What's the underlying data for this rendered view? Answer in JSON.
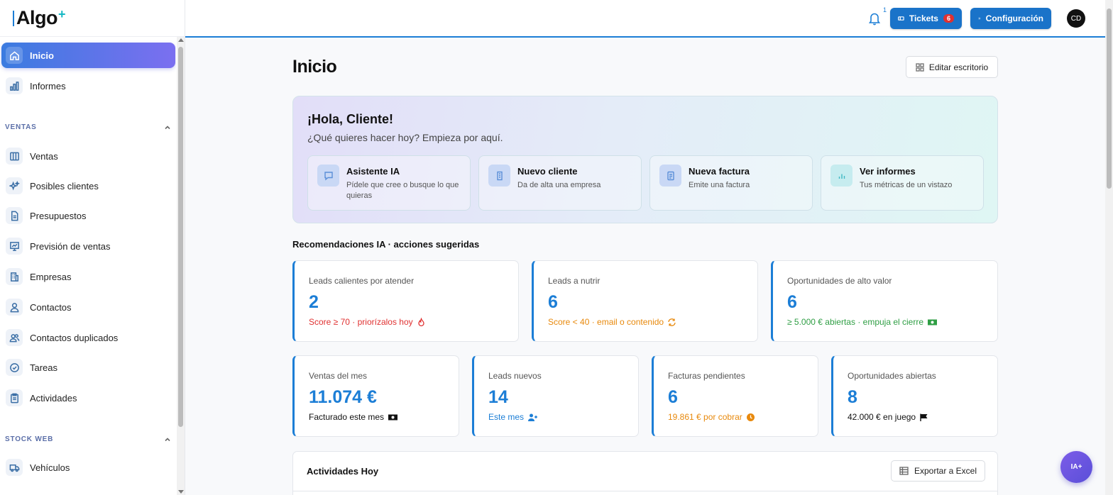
{
  "app": {
    "logo_text": "Algo",
    "logo_plus": "+"
  },
  "topbar": {
    "notifications_count": "1",
    "tickets_label": "Tickets",
    "tickets_badge": "6",
    "config_label": "Configuración",
    "avatar_initials": "CD"
  },
  "sidebar": {
    "items": [
      {
        "label": "Inicio",
        "icon": "home-icon"
      },
      {
        "label": "Informes",
        "icon": "bar-chart-icon"
      }
    ],
    "sections": [
      {
        "title": "VENTAS"
      },
      {
        "title": "STOCK WEB"
      }
    ],
    "ventas_items": [
      {
        "label": "Ventas",
        "icon": "columns-icon"
      },
      {
        "label": "Posibles clientes",
        "icon": "sparkles-icon"
      },
      {
        "label": "Presupuestos",
        "icon": "document-icon"
      },
      {
        "label": "Previsión de ventas",
        "icon": "presentation-chart-icon"
      },
      {
        "label": "Empresas",
        "icon": "building-icon"
      },
      {
        "label": "Contactos",
        "icon": "user-icon"
      },
      {
        "label": "Contactos duplicados",
        "icon": "users-icon"
      },
      {
        "label": "Tareas",
        "icon": "check-circle-icon"
      },
      {
        "label": "Actividades",
        "icon": "clipboard-icon"
      }
    ],
    "stock_items": [
      {
        "label": "Vehículos",
        "icon": "truck-icon"
      }
    ]
  },
  "main": {
    "title": "Inicio",
    "edit_button": "Editar escritorio",
    "hero": {
      "greeting": "¡Hola, Cliente!",
      "subtitle": "¿Qué quieres hacer hoy? Empieza por aquí.",
      "actions": [
        {
          "title": "Asistente IA",
          "desc": "Pídele que cree o busque lo que quieras",
          "icon": "chat-icon"
        },
        {
          "title": "Nuevo cliente",
          "desc": "Da de alta una empresa",
          "icon": "building-icon"
        },
        {
          "title": "Nueva factura",
          "desc": "Emite una factura",
          "icon": "invoice-icon"
        },
        {
          "title": "Ver informes",
          "desc": "Tus métricas de un vistazo",
          "icon": "bar-chart-icon"
        }
      ]
    },
    "recommendations_title": "Recomendaciones IA · acciones sugeridas",
    "recommendations": [
      {
        "title": "Leads calientes por atender",
        "value": "2",
        "sub": "Score ≥ 70 · priorízalos hoy",
        "sub_color": "#e03131",
        "icon": "fire-icon"
      },
      {
        "title": "Leads a nutrir",
        "value": "6",
        "sub": "Score < 40 · email o contenido",
        "sub_color": "#e8890c",
        "icon": "refresh-icon"
      },
      {
        "title": "Oportunidades de alto valor",
        "value": "6",
        "sub": "≥ 5.000 € abiertas · empuja el cierre",
        "sub_color": "#2f9e44",
        "icon": "money-icon"
      }
    ],
    "kpis": [
      {
        "title": "Ventas del mes",
        "value": "11.074 €",
        "sub": "Facturado este mes",
        "sub_color": "#111111",
        "icon": "money-icon"
      },
      {
        "title": "Leads nuevos",
        "value": "14",
        "sub": "Este mes",
        "sub_color": "#1c7ed6",
        "icon": "user-plus-icon"
      },
      {
        "title": "Facturas pendientes",
        "value": "6",
        "sub": "19.861 € por cobrar",
        "sub_color": "#e8890c",
        "icon": "clock-icon"
      },
      {
        "title": "Oportunidades abiertas",
        "value": "8",
        "sub": "42.000 € en juego",
        "sub_color": "#111111",
        "icon": "flag-icon"
      }
    ],
    "activities": {
      "title": "Actividades Hoy",
      "export_button": "Exportar a Excel"
    },
    "ia_button": "IA+"
  },
  "colors": {
    "accent": "#1c7ed6",
    "sidebar_active_start": "#3b7be0",
    "sidebar_active_end": "#7b6ff0"
  }
}
